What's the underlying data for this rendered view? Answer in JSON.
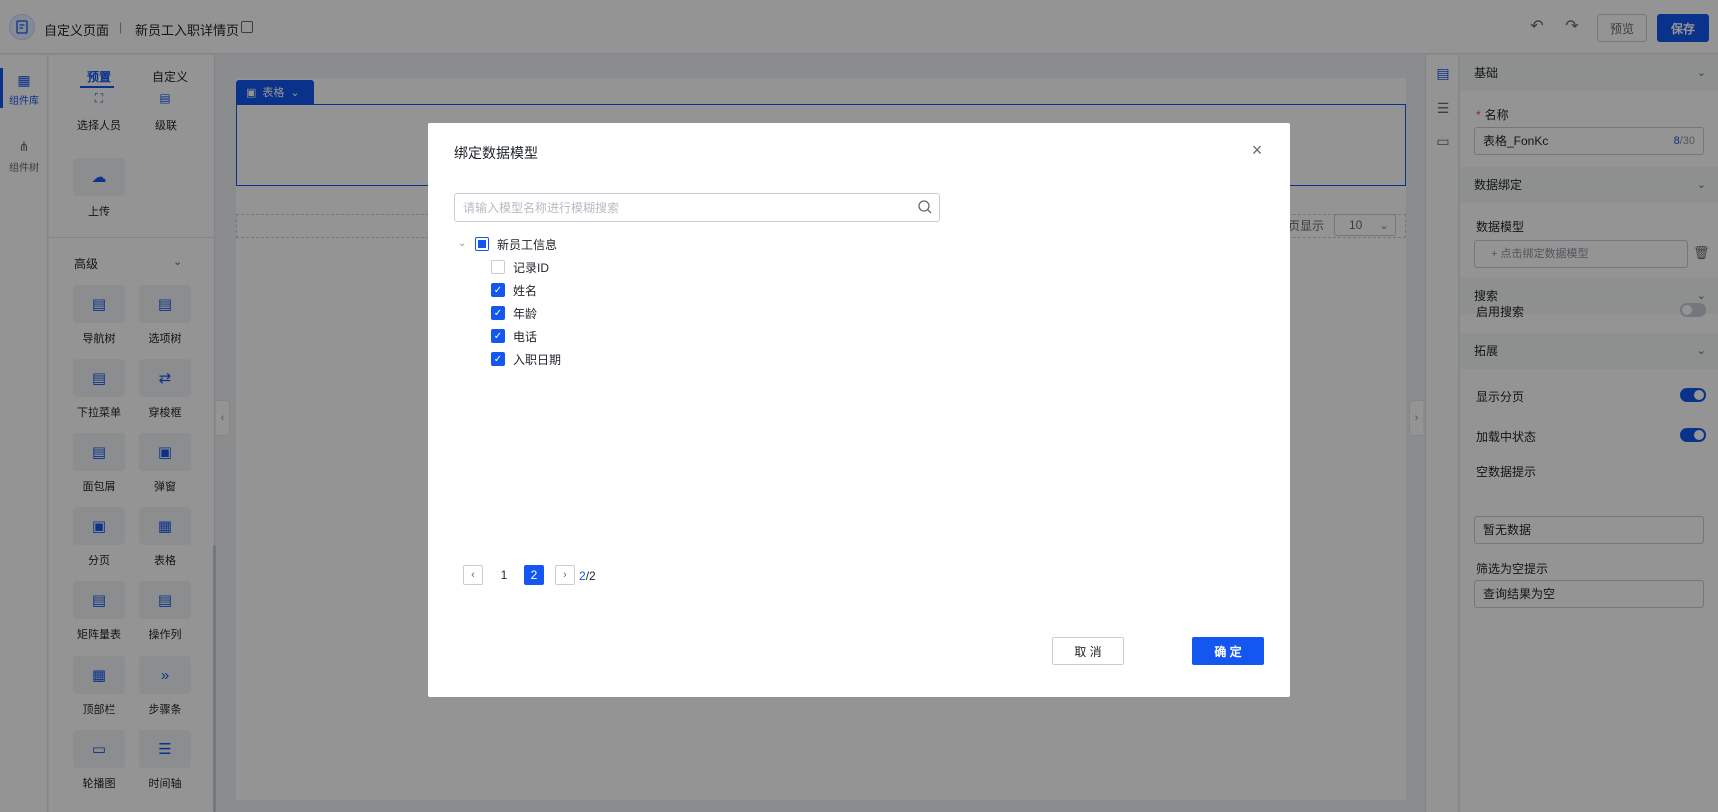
{
  "header": {
    "page_type": "自定义页面",
    "separator": "|",
    "page_name": "新员工入职详情页",
    "preview_label": "预览",
    "save_label": "保存"
  },
  "rail": {
    "items": [
      {
        "label": "组件库",
        "icon": "grid-icon",
        "active": true
      },
      {
        "label": "组件树",
        "icon": "tree-icon",
        "active": false
      }
    ]
  },
  "panel": {
    "tabs": [
      {
        "label": "预置",
        "active": true
      },
      {
        "label": "自定义",
        "active": false
      }
    ],
    "basic_components": [
      {
        "label": "选择人员",
        "icon": "person-select-icon"
      },
      {
        "label": "级联",
        "icon": "cascade-icon"
      },
      {
        "label": "上传",
        "icon": "upload-icon"
      }
    ],
    "advanced_section_title": "高级",
    "advanced_components": [
      {
        "label": "导航树",
        "icon": "nav-tree-icon"
      },
      {
        "label": "选项树",
        "icon": "option-tree-icon"
      },
      {
        "label": "下拉菜单",
        "icon": "dropdown-icon"
      },
      {
        "label": "穿梭框",
        "icon": "transfer-icon"
      },
      {
        "label": "面包屑",
        "icon": "breadcrumb-icon"
      },
      {
        "label": "弹窗",
        "icon": "dialog-icon"
      },
      {
        "label": "分页",
        "icon": "pagination-icon"
      },
      {
        "label": "表格",
        "icon": "table-icon"
      },
      {
        "label": "矩阵量表",
        "icon": "matrix-icon"
      },
      {
        "label": "操作列",
        "icon": "action-column-icon"
      },
      {
        "label": "顶部栏",
        "icon": "topbar-icon"
      },
      {
        "label": "步骤条",
        "icon": "steps-icon"
      },
      {
        "label": "轮播图",
        "icon": "carousel-icon"
      },
      {
        "label": "时间轴",
        "icon": "timeline-icon"
      }
    ]
  },
  "canvas": {
    "selected_tag": "表格",
    "page_size_hint": "页显示",
    "page_size_value": "10"
  },
  "props": {
    "basic_section": "基础",
    "name_label": "名称",
    "name_value": "表格_FonKc",
    "name_count": "8",
    "name_max": "/30",
    "data_binding_section": "数据绑定",
    "data_model_label": "数据模型",
    "bind_placeholder": "点击绑定数据模型",
    "search_section": "搜索",
    "enable_search_label": "启用搜索",
    "enable_search": false,
    "extend_section": "拓展",
    "show_pagination_label": "显示分页",
    "show_pagination": true,
    "loading_state_label": "加载中状态",
    "loading_state": true,
    "empty_tip_label": "空数据提示",
    "empty_tip_value": "暂无数据",
    "filter_empty_label": "筛选为空提示",
    "filter_empty_value": "查询结果为空"
  },
  "modal": {
    "title": "绑定数据模型",
    "search_placeholder": "请输入模型名称进行模糊搜索",
    "tree_root": {
      "label": "新员工信息",
      "state": "partial"
    },
    "fields": [
      {
        "label": "记录ID",
        "checked": false
      },
      {
        "label": "姓名",
        "checked": true
      },
      {
        "label": "年龄",
        "checked": true
      },
      {
        "label": "电话",
        "checked": true
      },
      {
        "label": "入职日期",
        "checked": true
      }
    ],
    "pagination": {
      "pages": [
        "1",
        "2"
      ],
      "current": "2",
      "total_current": "2",
      "total_sep": "/",
      "total_pages": "2"
    },
    "cancel_label": "取 消",
    "ok_label": "确 定"
  },
  "colors": {
    "accent": "#1456f0",
    "overlay": "rgba(0,0,0,0.42)"
  }
}
